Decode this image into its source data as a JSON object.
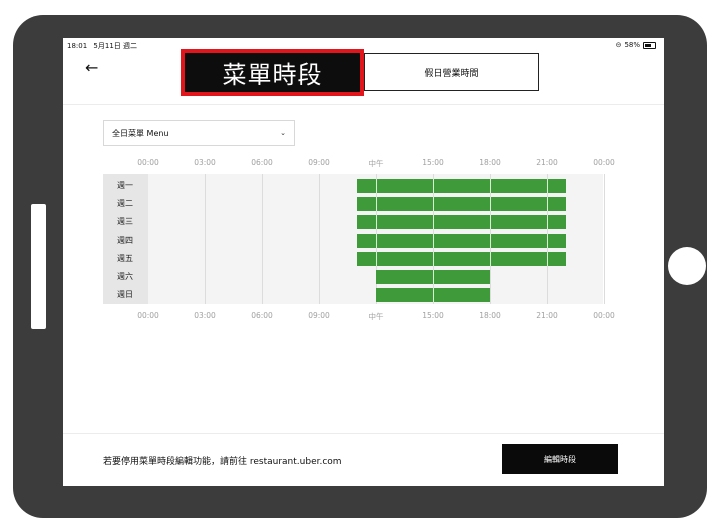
{
  "status_bar": {
    "time": "18:01",
    "date": "5月11日 週二",
    "battery": "58%"
  },
  "header": {
    "back_icon": "arrow-left-icon",
    "tab_active_label": "菜單時段",
    "tab_holiday_label": "假日營業時間"
  },
  "menu_select": {
    "value": "全日菜單 Menu",
    "icon": "chevron-down-icon"
  },
  "schedule": {
    "hours": [
      "00:00",
      "03:00",
      "06:00",
      "09:00",
      "中午",
      "15:00",
      "18:00",
      "21:00",
      "00:00"
    ],
    "days": [
      {
        "label": "週一",
        "open": "11:00",
        "close": "22:00"
      },
      {
        "label": "週二",
        "open": "11:00",
        "close": "22:00"
      },
      {
        "label": "週三",
        "open": "11:00",
        "close": "22:00"
      },
      {
        "label": "週四",
        "open": "11:00",
        "close": "22:00"
      },
      {
        "label": "週五",
        "open": "11:00",
        "close": "22:00"
      },
      {
        "label": "週六",
        "open": "12:00",
        "close": "18:00"
      },
      {
        "label": "週日",
        "open": "12:00",
        "close": "18:00"
      }
    ],
    "bar_color": "#3f9b3a"
  },
  "footer": {
    "text": "若要停用菜單時段編輯功能，請前往 restaurant.uber.com",
    "edit_button_label": "編輯時段"
  },
  "colors": {
    "highlight_border": "#e0161c",
    "active_tab_bg": "#0d0d0d",
    "device_frame": "#3c3c3c"
  }
}
